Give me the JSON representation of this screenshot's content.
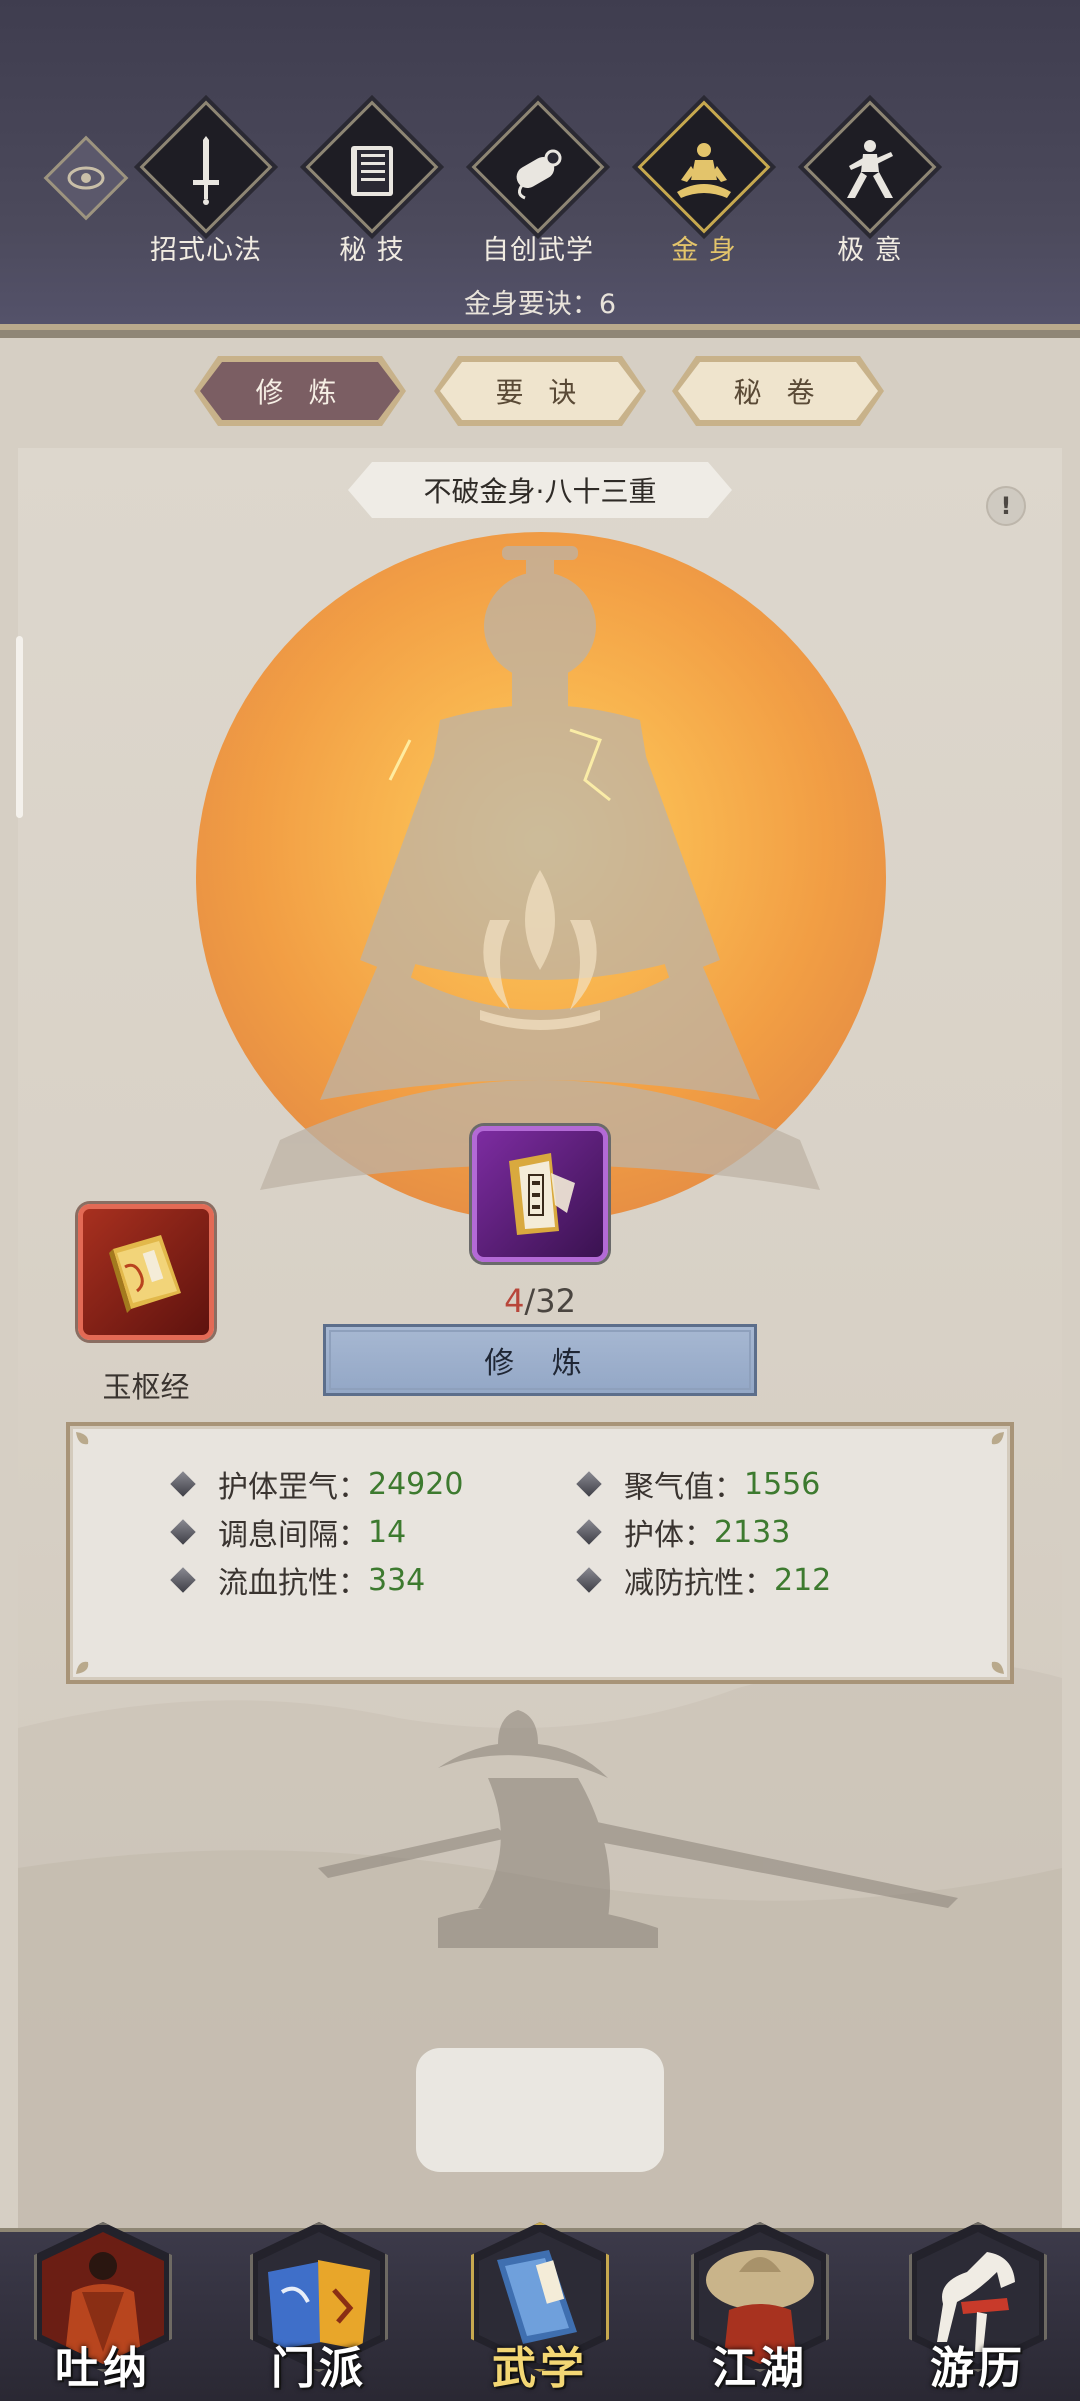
{
  "top_tabs": [
    {
      "label": "招式心法",
      "icon": "sword-icon"
    },
    {
      "label": "秘 技",
      "icon": "book-icon"
    },
    {
      "label": "自创武学",
      "icon": "scroll-icon"
    },
    {
      "label": "金 身",
      "icon": "meditation-icon",
      "active": true
    },
    {
      "label": "极 意",
      "icon": "martial-pose-icon"
    }
  ],
  "header_sub": "金身要诀：6",
  "sub_tabs": [
    {
      "label": "修 炼",
      "active": true
    },
    {
      "label": "要 诀"
    },
    {
      "label": "秘 卷"
    }
  ],
  "title_banner": "不破金身·八十三重",
  "info_symbol": "!",
  "center_item": {
    "icon": "yushu-scroll-icon",
    "progress_current": "4",
    "progress_total": "/32"
  },
  "left_item": {
    "name": "玉枢经",
    "icon": "yushu-book-icon"
  },
  "train_button": "修 炼",
  "stats": [
    {
      "label": "护体罡气：",
      "value": "24920"
    },
    {
      "label": "聚气值：",
      "value": "1556"
    },
    {
      "label": "调息间隔：",
      "value": "14"
    },
    {
      "label": "护体：",
      "value": "2133"
    },
    {
      "label": "流血抗性：",
      "value": "334"
    },
    {
      "label": "减防抗性：",
      "value": "212"
    }
  ],
  "bottom_nav": [
    {
      "label": "吐纳"
    },
    {
      "label": "门派"
    },
    {
      "label": "武学",
      "active": true
    },
    {
      "label": "江湖"
    },
    {
      "label": "游历"
    }
  ],
  "colors": {
    "header_bg": "#4c4a5c",
    "active_gold": "#e3c46b",
    "stat_value_green": "#3d7a2f",
    "progress_red": "#b8463a",
    "train_button_blue": "#9aadc9"
  }
}
